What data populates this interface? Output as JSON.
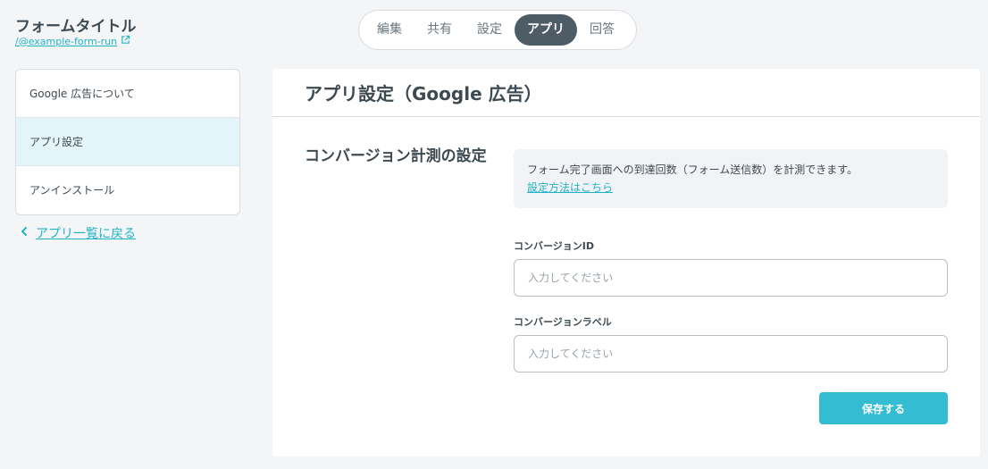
{
  "header": {
    "form_title": "フォームタイトル",
    "form_link": "/@example-form-run",
    "tabs": [
      {
        "label": "編集",
        "active": false
      },
      {
        "label": "共有",
        "active": false
      },
      {
        "label": "設定",
        "active": false
      },
      {
        "label": "アプリ",
        "active": true
      },
      {
        "label": "回答",
        "active": false
      }
    ]
  },
  "sidebar": {
    "items": [
      {
        "label": "Google 広告について",
        "active": false
      },
      {
        "label": "アプリ設定",
        "active": true
      },
      {
        "label": "アンインストール",
        "active": false
      }
    ],
    "back_link": "アプリ一覧に戻る"
  },
  "main": {
    "title": "アプリ設定（Google 広告）",
    "section_title": "コンバージョン計測の設定",
    "info_text": "フォーム完了画面への到達回数（フォーム送信数）を計測できます。",
    "info_link": "設定方法はこちら",
    "conversion_id_label": "コンバージョンID",
    "conversion_id_placeholder": "入力してください",
    "conversion_id_value": "",
    "conversion_label_label": "コンバージョンラベル",
    "conversion_label_placeholder": "入力してください",
    "conversion_label_value": "",
    "save_label": "保存する"
  },
  "colors": {
    "accent": "#34bcd3",
    "link": "#21b3c7",
    "tab_active": "#4e5c66",
    "sidebar_active": "#e3f5f9"
  },
  "icons": {
    "external_link": "external-link-icon",
    "back": "chevron-left-icon"
  }
}
